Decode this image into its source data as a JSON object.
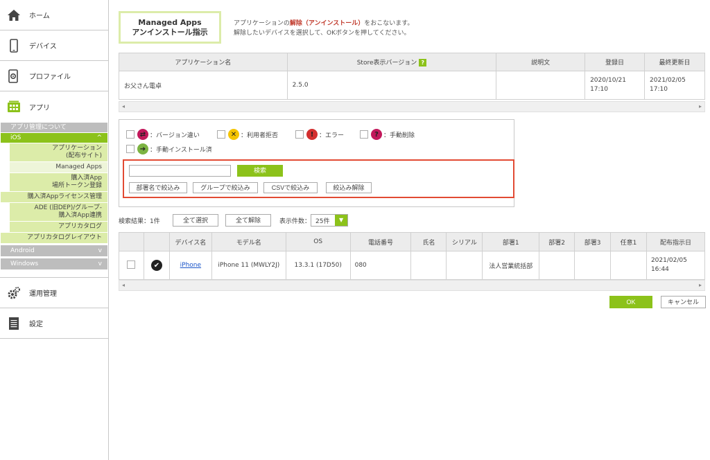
{
  "sidebar": {
    "home": "ホーム",
    "devices": "デバイス",
    "profile": "プロファイル",
    "apps": "アプリ",
    "about_apps": "アプリ管理について",
    "ios": "iOS",
    "ios_items": [
      "アプリケーション\n(配布サイト)",
      "Managed Apps",
      "購入済App\n場所トークン登録",
      "購入済Appライセンス管理",
      "ADE (旧DEP)/グループ-\n購入済App連携",
      "アプリカタログ",
      "アプリカタログレイアウト"
    ],
    "android": "Android",
    "windows": "Windows",
    "operations": "運用管理",
    "settings": "設定",
    "ios_chevron": "^",
    "os_chevron": "v"
  },
  "title": {
    "line1": "Managed Apps",
    "line2": "アンインストール指示"
  },
  "description": {
    "pre": "アプリケーションの",
    "highlight": "解除（アンインストール）",
    "post": "をおこないます。",
    "line2": "解除したいデバイスを選択して、OKボタンを押してください。"
  },
  "app_table": {
    "headers": [
      "アプリケーション名",
      "Store表示バージョン",
      "説明文",
      "登録日",
      "最終更新日"
    ],
    "help": "?",
    "row": {
      "name": "お父さん電卓",
      "version": "2.5.0",
      "description": "",
      "registered": [
        "2020/10/21",
        "17:10"
      ],
      "updated": [
        "2021/02/05",
        "17:10"
      ]
    }
  },
  "scroll": {
    "left": "◂",
    "right": "▸"
  },
  "legend": {
    "version_diff": "：バージョン違い",
    "user_rejected": "：利用者拒否",
    "error": "：エラー",
    "manual_delete": "：手動削除",
    "manual_install": "：手動インストール済"
  },
  "search": {
    "placeholder": "",
    "button": "検索",
    "filter_dept": "部署名で絞込み",
    "filter_group": "グループで絞込み",
    "filter_csv": "CSVで絞込み",
    "filter_clear": "絞込み解除"
  },
  "results": {
    "count_label": "検索結果：1件",
    "select_all": "全て選択",
    "deselect_all": "全て解除",
    "per_page_label": "表示件数：",
    "per_page_value": "25件"
  },
  "device_table": {
    "headers": [
      "",
      "",
      "デバイス名",
      "モデル名",
      "OS",
      "電話番号",
      "氏名",
      "シリアル",
      "部署1",
      "部署2",
      "部署3",
      "任意1",
      "配布指示日"
    ],
    "row": {
      "device": "iPhone",
      "model": "iPhone 11 (MWLY2J)",
      "os": "13.3.1 (17D50)",
      "phone": "080",
      "name": "",
      "serial": "",
      "dept1": "法人営業統括部",
      "dept2": "",
      "dept3": "",
      "custom1": "",
      "date": [
        "2021/02/05",
        "16:44"
      ]
    }
  },
  "actions": {
    "ok": "OK",
    "cancel": "キャンセル"
  },
  "colors": {
    "accent": "#8cc21a",
    "highlight_border": "#e24a33",
    "sub_bg": "#dceca9"
  }
}
